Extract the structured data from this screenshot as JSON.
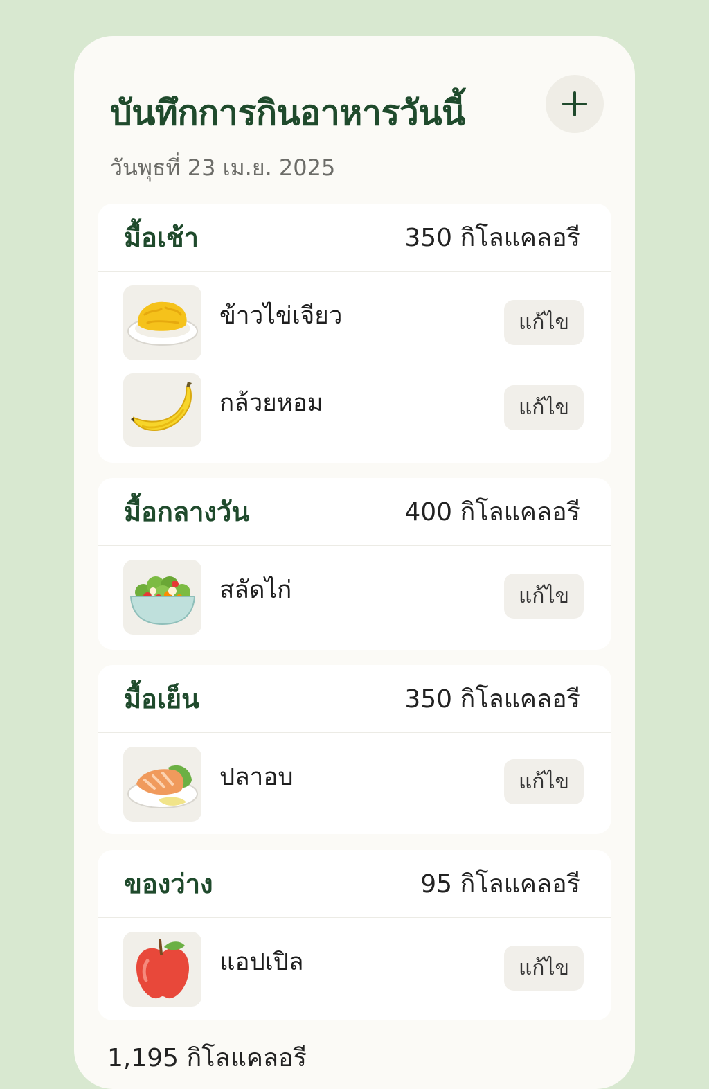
{
  "header": {
    "title": "บันทึกการกินอาหารวันนี้",
    "date": "วันพุธที่ 23 เม.ย. 2025",
    "add_label": "+"
  },
  "meals": [
    {
      "name": "มื้อเช้า",
      "calories": "350 กิโลแคลอรี",
      "items": [
        {
          "name": "ข้าวไข่เจียว",
          "icon": "omelette-rice-icon",
          "edit_label": "แก้ไข"
        },
        {
          "name": "กล้วยหอม",
          "icon": "banana-icon",
          "edit_label": "แก้ไข"
        }
      ]
    },
    {
      "name": "มื้อกลางวัน",
      "calories": "400 กิโลแคลอรี",
      "items": [
        {
          "name": "สลัดไก่",
          "icon": "chicken-salad-icon",
          "edit_label": "แก้ไข"
        }
      ]
    },
    {
      "name": "มื้อเย็น",
      "calories": "350 กิโลแคลอรี",
      "items": [
        {
          "name": "ปลาอบ",
          "icon": "baked-fish-icon",
          "edit_label": "แก้ไข"
        }
      ]
    },
    {
      "name": "ของว่าง",
      "calories": "95 กิโลแคลอรี",
      "items": [
        {
          "name": "แอปเปิล",
          "icon": "apple-icon",
          "edit_label": "แก้ไข"
        }
      ]
    }
  ],
  "total": "1,195 กิโลแคลอรี",
  "colors": {
    "background": "#d8e8d0",
    "card": "#fbfaf6",
    "accent_green": "#1f4a2c"
  }
}
